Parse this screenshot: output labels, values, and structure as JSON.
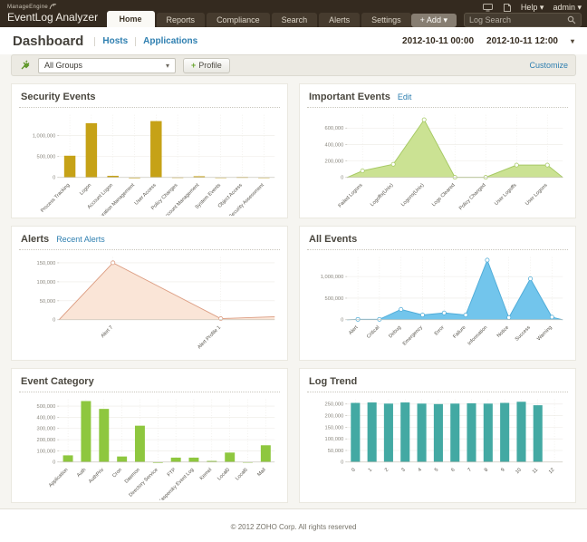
{
  "header": {
    "brand_small": "ManageEngine",
    "brand_large": "EventLog Analyzer",
    "tabs": [
      {
        "label": "Home",
        "active": true
      },
      {
        "label": "Reports",
        "active": false
      },
      {
        "label": "Compliance",
        "active": false
      },
      {
        "label": "Search",
        "active": false
      },
      {
        "label": "Alerts",
        "active": false
      },
      {
        "label": "Settings",
        "active": false
      }
    ],
    "help_label": "Help",
    "admin_label": "admin",
    "add_button": "+ Add",
    "caret": "▾",
    "search_placeholder": "Log Search",
    "icons": [
      "monitor-icon",
      "document-icon",
      "search-icon"
    ]
  },
  "subheader": {
    "title": "Dashboard",
    "links": [
      "Hosts",
      "Applications"
    ],
    "date_from": "2012-10-11 00:00",
    "date_to": "2012-10-11 12:00"
  },
  "toolbar": {
    "group_select": "All Groups",
    "group_icon": "plug-icon",
    "profile_plus": "+",
    "profile_button": "Profile",
    "customize_link": "Customize"
  },
  "footer": {
    "copyright": "© 2012 ZOHO Corp. All rights reserved"
  },
  "chart_data": [
    {
      "type": "bar",
      "title": "Security Events",
      "categories": [
        "Process Tracking",
        "Logon",
        "Account Logon",
        "Configuration Management",
        "User Access",
        "Policy Changes",
        "Account Management",
        "System Events",
        "Object Access",
        "Security Assessment"
      ],
      "values": [
        520000,
        1300000,
        40000,
        2000,
        1350000,
        8000,
        30000,
        6000,
        12000,
        6000
      ],
      "yticks": [
        0,
        500000,
        1000000
      ],
      "ylim": [
        0,
        1500000
      ],
      "color": "#c6a217"
    },
    {
      "type": "area",
      "title": "Important Events",
      "link": "Edit",
      "categories": [
        "Failed Logons",
        "Logoffs(Unix)",
        "Logons(Unix)",
        "Logs Cleared",
        "Policy Changed",
        "User Logoffs",
        "User Logons"
      ],
      "values": [
        80000,
        160000,
        700000,
        2000,
        2000,
        150000,
        150000
      ],
      "yticks": [
        0,
        200000,
        400000,
        600000
      ],
      "ylim": [
        0,
        760000
      ],
      "color": "#a6c964",
      "fill": "#cbe293"
    },
    {
      "type": "area",
      "title": "Alerts",
      "link": "Recent Alerts",
      "categories": [
        "Alert 7",
        "Alert Profile 1"
      ],
      "values": [
        150000,
        3000
      ],
      "edge_end": 8000,
      "yticks": [
        0,
        50000,
        100000,
        150000
      ],
      "ylim": [
        0,
        165000
      ],
      "color": "#dc9d82",
      "fill": "#fae5d7"
    },
    {
      "type": "area",
      "title": "All Events",
      "categories": [
        "Alert",
        "Critical",
        "Debug",
        "Emergency",
        "Error",
        "Failure",
        "Information",
        "Notice",
        "Success",
        "Warning"
      ],
      "values": [
        10000,
        10000,
        240000,
        110000,
        160000,
        110000,
        1380000,
        50000,
        950000,
        60000
      ],
      "yticks": [
        0,
        500000,
        1000000
      ],
      "ylim": [
        0,
        1450000
      ],
      "color": "#4facd8",
      "fill": "#72c5ec"
    },
    {
      "type": "bar",
      "title": "Event Category",
      "categories": [
        "Application",
        "Auth",
        "AuthPriv",
        "Cron",
        "Daemon",
        "Directory Service",
        "FTP",
        "Kaspersky Event Log",
        "Kernel",
        "Local0",
        "Local6",
        "Mail"
      ],
      "values": [
        60000,
        545000,
        475000,
        50000,
        325000,
        1000,
        40000,
        40000,
        10000,
        85000,
        2000,
        150000
      ],
      "yticks": [
        0,
        100000,
        200000,
        300000,
        400000,
        500000
      ],
      "ylim": [
        0,
        560000
      ],
      "color": "#8ec73f"
    },
    {
      "type": "bar",
      "title": "Log Trend",
      "categories": [
        "0",
        "1",
        "2",
        "3",
        "4",
        "5",
        "6",
        "7",
        "8",
        "9",
        "10",
        "11",
        "12"
      ],
      "values": [
        255000,
        257000,
        252000,
        257000,
        252000,
        250000,
        252000,
        253000,
        252000,
        255000,
        260000,
        245000,
        0
      ],
      "yticks": [
        0,
        50000,
        100000,
        150000,
        200000,
        250000
      ],
      "ylim": [
        0,
        270000
      ],
      "color": "#43a9a3"
    }
  ]
}
